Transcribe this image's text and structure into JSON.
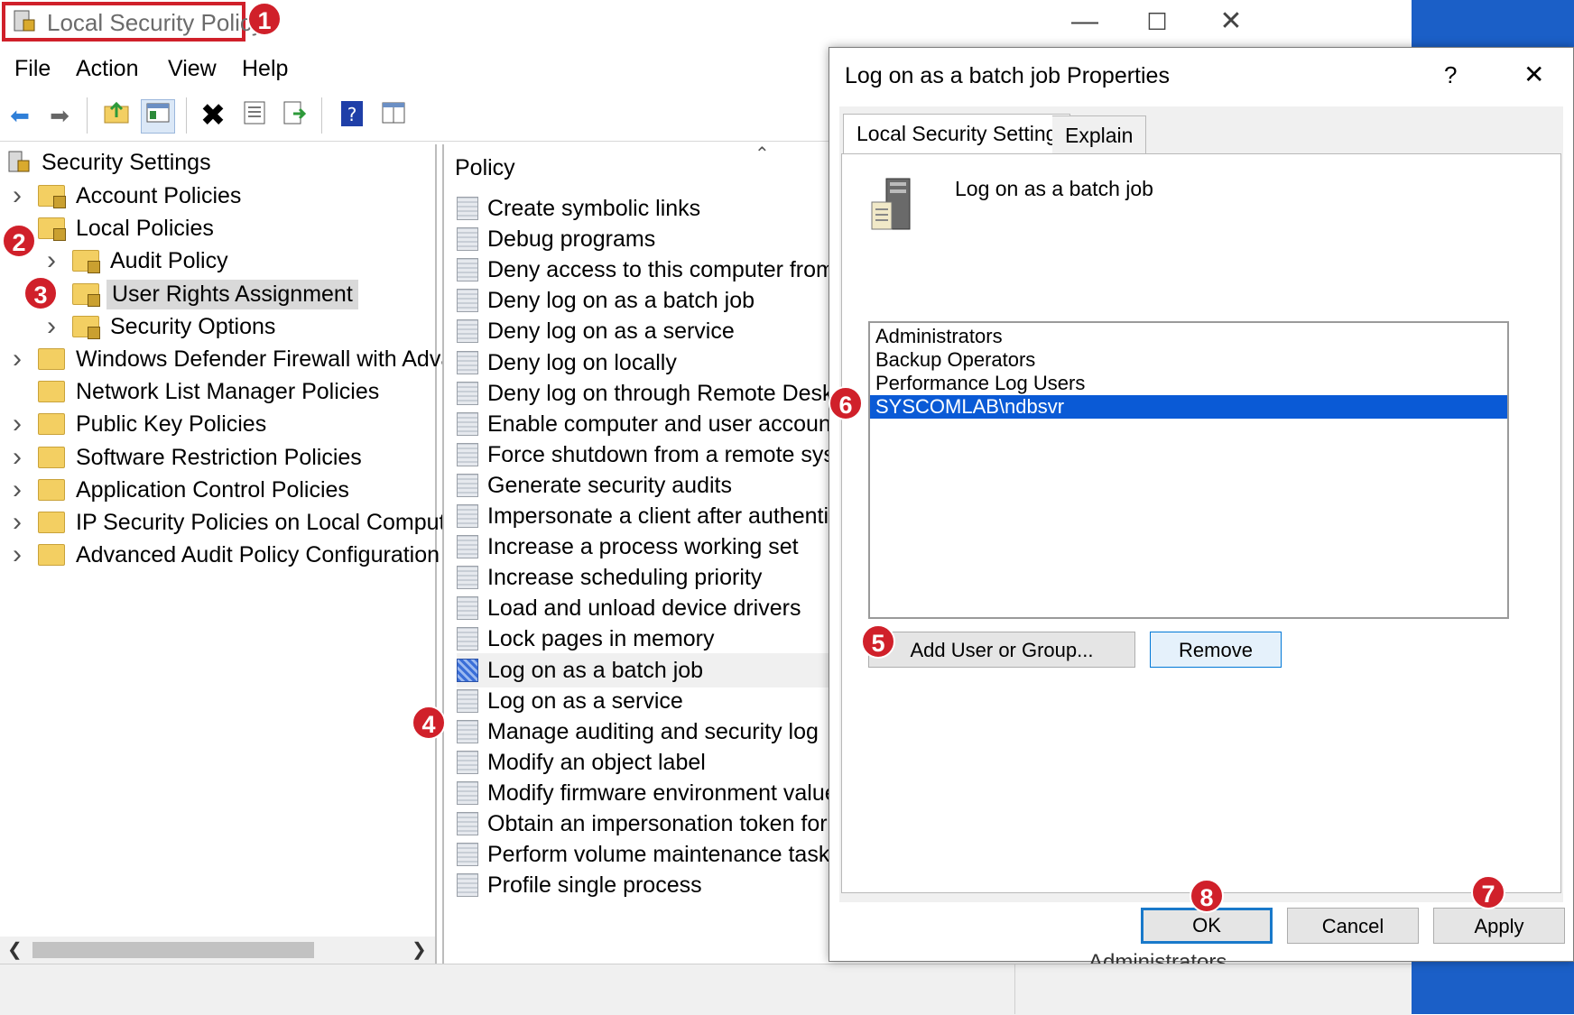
{
  "window": {
    "title": "Local Security Policy",
    "minimize": "—",
    "maximize": "☐",
    "close": "✕"
  },
  "menu": [
    "File",
    "Action",
    "View",
    "Help"
  ],
  "tree": {
    "root": "Security Settings",
    "items": [
      {
        "label": "Account Policies",
        "level": 1,
        "expander": true,
        "lock": true
      },
      {
        "label": "Local Policies",
        "level": 1,
        "expander": false,
        "lock": true
      },
      {
        "label": "Audit Policy",
        "level": 2,
        "expander": true,
        "lock": true
      },
      {
        "label": "User Rights Assignment",
        "level": 2,
        "expander": false,
        "lock": true,
        "selected": true
      },
      {
        "label": "Security Options",
        "level": 2,
        "expander": true,
        "lock": true
      },
      {
        "label": "Windows Defender Firewall with Adva",
        "level": 1,
        "expander": true,
        "lock": false
      },
      {
        "label": "Network List Manager Policies",
        "level": 1,
        "expander": false,
        "lock": false
      },
      {
        "label": "Public Key Policies",
        "level": 1,
        "expander": true,
        "lock": false
      },
      {
        "label": "Software Restriction Policies",
        "level": 1,
        "expander": true,
        "lock": false
      },
      {
        "label": "Application Control Policies",
        "level": 1,
        "expander": true,
        "lock": false
      },
      {
        "label": "IP Security Policies on Local Compute",
        "level": 1,
        "expander": true,
        "lock": false
      },
      {
        "label": "Advanced Audit Policy Configuration",
        "level": 1,
        "expander": true,
        "lock": false
      }
    ]
  },
  "policy_list": {
    "header": "Policy",
    "items": [
      "Create symbolic links",
      "Debug programs",
      "Deny access to this computer from t",
      "Deny log on as a batch job",
      "Deny log on as a service",
      "Deny log on locally",
      "Deny log on through Remote Deskto",
      "Enable computer and user accounts",
      "Force shutdown from a remote syste",
      "Generate security audits",
      "Impersonate a client after authentica",
      "Increase a process working set",
      "Increase scheduling priority",
      "Load and unload device drivers",
      "Lock pages in memory",
      "Log on as a batch job",
      "Log on as a service",
      "Manage auditing and security log",
      "Modify an object label",
      "Modify firmware environment value",
      "Obtain an impersonation token for a",
      "Perform volume maintenance tasks",
      "Profile single process"
    ],
    "selected_index": 15,
    "partial_text_below": "Administrators"
  },
  "dialog": {
    "title": "Log on as a batch job Properties",
    "help": "?",
    "close": "✕",
    "tabs": [
      "Local Security Setting",
      "Explain"
    ],
    "active_tab": 0,
    "policy_name": "Log on as a batch job",
    "users": [
      "Administrators",
      "Backup Operators",
      "Performance Log Users",
      "SYSCOMLAB\\ndbsvr"
    ],
    "selected_user_index": 3,
    "add_button": "Add User or Group...",
    "remove_button": "Remove",
    "ok_button": "OK",
    "cancel_button": "Cancel",
    "apply_button": "Apply"
  },
  "badges": [
    "1",
    "2",
    "3",
    "4",
    "5",
    "6",
    "7",
    "8"
  ],
  "colors": {
    "badge": "#d0202a",
    "selection": "#0a5ad6",
    "focus_border": "#1979ca",
    "desktop": "#1b5fc7"
  }
}
